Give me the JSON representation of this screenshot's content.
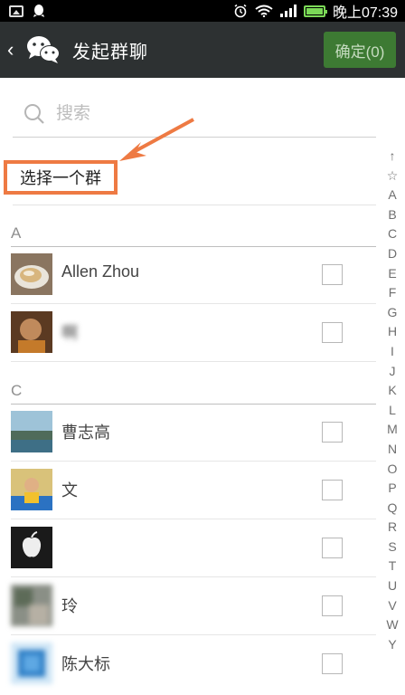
{
  "statusbar": {
    "time": "晚上07:39",
    "icons": [
      "gallery-icon",
      "qq-icon",
      "alarm-icon",
      "wifi-icon",
      "signal-icon",
      "battery-icon"
    ]
  },
  "header": {
    "back": "‹",
    "title": "发起群聊",
    "confirm": "确定(0)"
  },
  "search": {
    "placeholder": "搜索"
  },
  "select_group_label": "选择一个群",
  "sections": [
    {
      "letter": "A",
      "contacts": [
        {
          "name": "Allen Zhou"
        },
        {
          "name": "啊"
        }
      ]
    },
    {
      "letter": "C",
      "contacts": [
        {
          "name": "曹志高"
        },
        {
          "name": "文"
        },
        {
          "name": ""
        },
        {
          "name": "玲"
        },
        {
          "name": "陈大标"
        }
      ]
    }
  ],
  "index": [
    "↑",
    "☆",
    "A",
    "B",
    "C",
    "D",
    "E",
    "F",
    "G",
    "H",
    "I",
    "J",
    "K",
    "L",
    "M",
    "N",
    "O",
    "P",
    "Q",
    "R",
    "S",
    "T",
    "U",
    "V",
    "W",
    "Y"
  ],
  "colors": {
    "actionbar": "#2d3132",
    "confirm": "#3d7a33",
    "highlight": "#ee7a43"
  }
}
